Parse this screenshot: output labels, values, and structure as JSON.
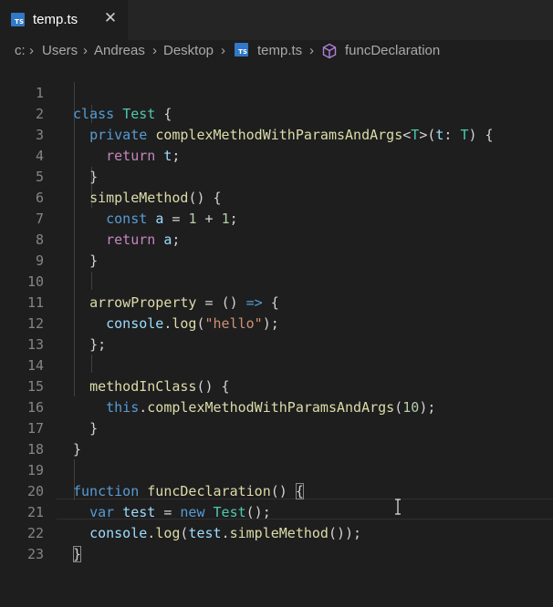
{
  "tab": {
    "label": "temp.ts",
    "icon": "typescript-file-icon",
    "badge_text": "TS",
    "close_glyph": "✕"
  },
  "breadcrumb": {
    "items": [
      "c:",
      "Users",
      "Andreas",
      "Desktop",
      "temp.ts",
      "funcDeclaration"
    ],
    "separator": "›",
    "file_icon": "typescript-file-icon",
    "symbol_icon": "symbol-method-icon"
  },
  "editor": {
    "current_line": 22,
    "lines": [
      {
        "num": "1",
        "text": "class Test {"
      },
      {
        "num": "2",
        "text": "  private complexMethodWithParamsAndArgs<T>(t: T) {"
      },
      {
        "num": "3",
        "text": "    return t;"
      },
      {
        "num": "4",
        "text": "  }"
      },
      {
        "num": "5",
        "text": "  simpleMethod() {"
      },
      {
        "num": "6",
        "text": "    const a = 1 + 1;"
      },
      {
        "num": "7",
        "text": "    return a;"
      },
      {
        "num": "8",
        "text": "  }"
      },
      {
        "num": "9",
        "text": ""
      },
      {
        "num": "10",
        "text": "  arrowProperty = () => {"
      },
      {
        "num": "11",
        "text": "    console.log(\"hello\");"
      },
      {
        "num": "12",
        "text": "  };"
      },
      {
        "num": "13",
        "text": ""
      },
      {
        "num": "14",
        "text": "  methodInClass() {"
      },
      {
        "num": "15",
        "text": "    this.complexMethodWithParamsAndArgs(10);"
      },
      {
        "num": "16",
        "text": "  }"
      },
      {
        "num": "17",
        "text": "}"
      },
      {
        "num": "18",
        "text": ""
      },
      {
        "num": "19",
        "text": "function funcDeclaration() {"
      },
      {
        "num": "20",
        "text": "  var test = new Test();"
      },
      {
        "num": "21",
        "text": "  console.log(test.simpleMethod());"
      },
      {
        "num": "22",
        "text": "}"
      },
      {
        "num": "23",
        "text": ""
      }
    ]
  },
  "colors": {
    "background": "#1e1e1e",
    "tabbar": "#252526",
    "line_number": "#858585",
    "keyword": "#569cd6",
    "control_keyword": "#c586c0",
    "type": "#4ec9b0",
    "function": "#dcdcaa",
    "variable": "#9cdcfe",
    "string": "#ce9178",
    "number": "#b5cea8",
    "text": "#d4d4d4",
    "ts_icon": "#3178c6",
    "symbol_icon": "#b180d7"
  }
}
